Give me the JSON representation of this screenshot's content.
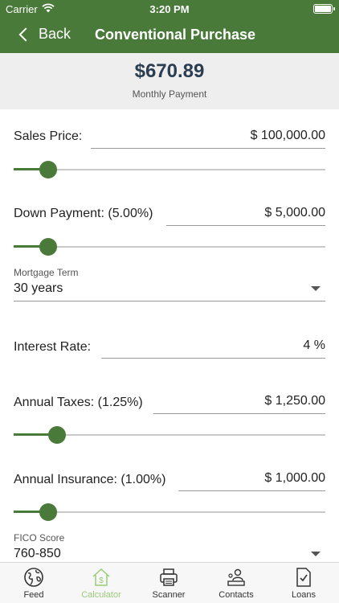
{
  "status_bar": {
    "carrier": "Carrier",
    "time": "3:20 PM"
  },
  "nav": {
    "back_label": "Back",
    "title": "Conventional Purchase"
  },
  "summary": {
    "amount": "$670.89",
    "caption": "Monthly Payment"
  },
  "fields": {
    "sales_price": {
      "label": "Sales Price:",
      "value": "$ 100,000.00",
      "slider_fraction": 0.11
    },
    "down_payment": {
      "label": "Down Payment: (5.00%)",
      "value": "$ 5,000.00",
      "slider_fraction": 0.11
    },
    "mortgage_term": {
      "label": "Mortgage Term",
      "value": "30 years"
    },
    "interest_rate": {
      "label": "Interest Rate:",
      "value": "4 %"
    },
    "annual_taxes": {
      "label": "Annual Taxes: (1.25%)",
      "value": "$ 1,250.00",
      "slider_fraction": 0.14
    },
    "annual_insurance": {
      "label": "Annual Insurance: (1.00%)",
      "value": "$ 1,000.00",
      "slider_fraction": 0.11
    },
    "fico_score": {
      "label": "FICO Score",
      "value": "760-850"
    }
  },
  "tabs": [
    {
      "label": "Feed",
      "icon": "globe-icon",
      "active": false
    },
    {
      "label": "Calculator",
      "icon": "house-dollar-icon",
      "active": true
    },
    {
      "label": "Scanner",
      "icon": "printer-icon",
      "active": false
    },
    {
      "label": "Contacts",
      "icon": "contacts-icon",
      "active": false
    },
    {
      "label": "Loans",
      "icon": "checklist-icon",
      "active": false
    }
  ],
  "colors": {
    "brand_green": "#4a7a3a",
    "active_tab": "#9ccb7c",
    "summary_bg": "#eeeeee",
    "amount_text": "#2b3d50"
  }
}
